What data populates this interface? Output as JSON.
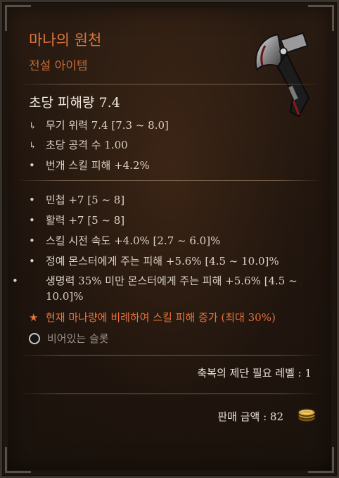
{
  "item": {
    "name": "마나의 원천",
    "type": "전설 아이템",
    "image": "axe-icon"
  },
  "weapon_stats": {
    "dps": "초당 피해량 7.4",
    "lines": [
      {
        "marker": "arrow",
        "text": "무기 위력 7.4 [7.3 ~ 8.0]"
      },
      {
        "marker": "arrow",
        "text": "초당 공격 수 1.00"
      },
      {
        "marker": "bullet",
        "text": "번개 스킬 피해 +4.2%"
      }
    ]
  },
  "affixes": [
    {
      "text": "민첩 +7 [5 ~ 8]"
    },
    {
      "text": "활력 +7 [5 ~ 8]"
    },
    {
      "text": "스킬 시전 속도 +4.0% [2.7 ~ 6.0]%"
    },
    {
      "text": "정예 몬스터에게 주는 피해 +5.6% [4.5 ~ 10.0]%"
    },
    {
      "text": "생명력 35% 미만 몬스터에게 주는 피해 +5.6% [4.5 ~ 10.0]%"
    }
  ],
  "legendary_aspect": "현재 마나량에 비례하여 스킬 피해 증가 (최대 30%)",
  "socket": "비어있는 슬롯",
  "requirement": "축복의 제단 필요 레벨 : 1",
  "sell_value": "판매 금액 : 82",
  "colors": {
    "legendary": "#e8733c",
    "text": "#d9d1c6",
    "background": "#21160f",
    "border": "#3a322b"
  },
  "icons": {
    "bullet": "•",
    "arrow": "↳",
    "star": "★",
    "coin": "coin-stack-icon"
  }
}
